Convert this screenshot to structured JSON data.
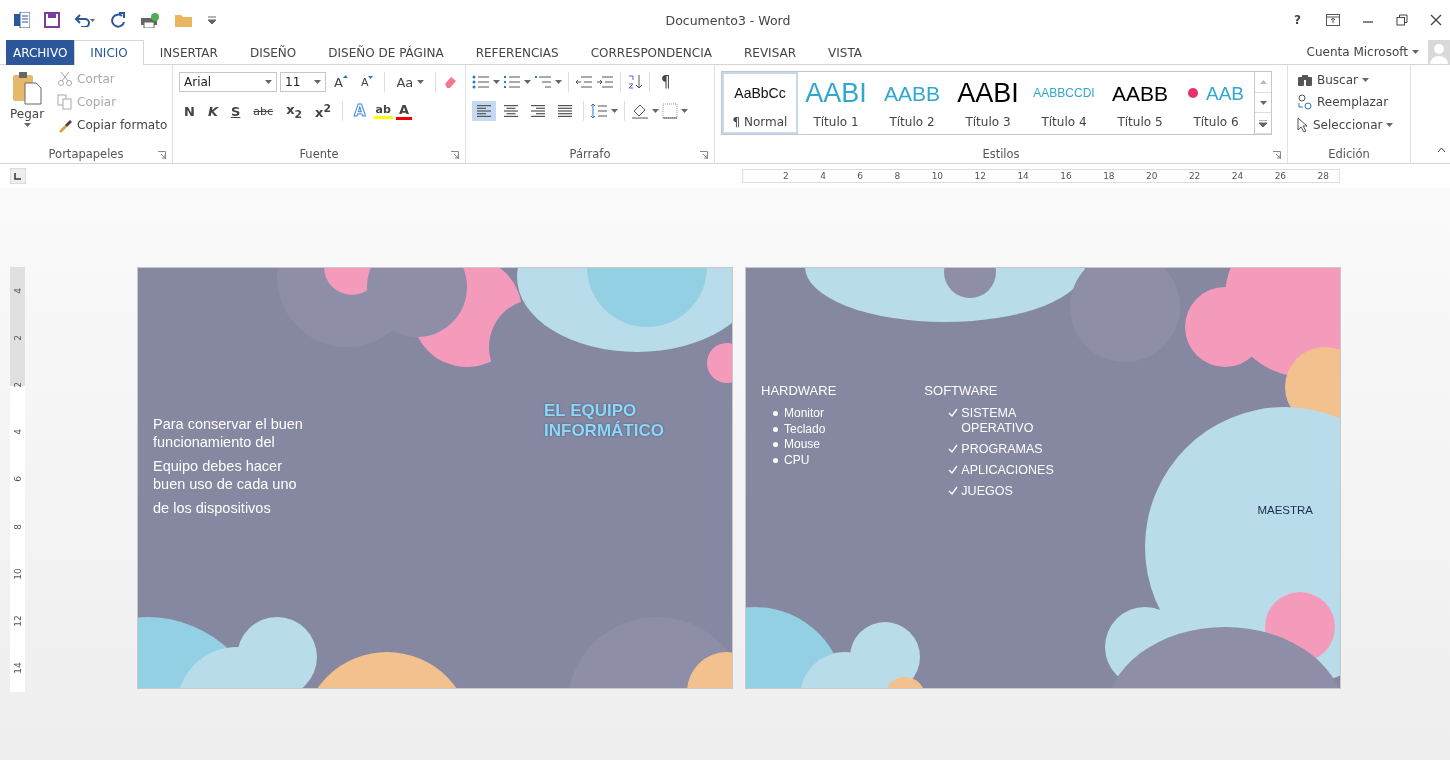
{
  "window": {
    "title": "Documento3 - Word",
    "help": "?",
    "account": "Cuenta Microsoft"
  },
  "tabs": [
    {
      "label": "ARCHIVO",
      "kind": "file",
      "selected": false
    },
    {
      "label": "INICIO",
      "kind": "tab",
      "selected": true
    },
    {
      "label": "INSERTAR",
      "kind": "tab",
      "selected": false
    },
    {
      "label": "DISEÑO",
      "kind": "tab",
      "selected": false
    },
    {
      "label": "DISEÑO DE PÁGINA",
      "kind": "tab",
      "selected": false
    },
    {
      "label": "REFERENCIAS",
      "kind": "tab",
      "selected": false
    },
    {
      "label": "CORRESPONDENCIA",
      "kind": "tab",
      "selected": false
    },
    {
      "label": "REVISAR",
      "kind": "tab",
      "selected": false
    },
    {
      "label": "VISTA",
      "kind": "tab",
      "selected": false
    }
  ],
  "ribbon": {
    "clipboard": {
      "paste": "Pegar",
      "items": [
        {
          "label": "Cortar",
          "kind": "cut",
          "disabled": true
        },
        {
          "label": "Copiar",
          "kind": "copy",
          "disabled": true
        },
        {
          "label": "Copiar formato",
          "kind": "brush",
          "disabled": false
        }
      ],
      "group": "Portapapeles"
    },
    "font": {
      "family": "Arial",
      "size": "11",
      "size_buttons": [
        "A",
        "A"
      ],
      "case_button": "Aa",
      "format_buttons": [
        "N",
        "K",
        "S",
        "abc",
        "x$_{2}$",
        "x$^{2}$"
      ],
      "effect_buttons": [
        "A",
        "ab",
        "A"
      ],
      "group": "Fuente"
    },
    "paragraph": {
      "marks_button": "¶",
      "alignments": [
        {
          "kind": "left",
          "selected": true
        },
        {
          "kind": "center",
          "selected": false
        },
        {
          "kind": "right",
          "selected": false
        },
        {
          "kind": "justify",
          "selected": false
        }
      ],
      "group": "Párrafo"
    },
    "styles": {
      "items": [
        {
          "preview": "AaBbCc",
          "label": "¶ Normal",
          "selected": true
        },
        {
          "preview": "AABI",
          "label": "Título 1",
          "selected": false
        },
        {
          "preview": "AABB",
          "label": "Título 2",
          "selected": false
        },
        {
          "preview": "AABI",
          "label": "Título 3",
          "selected": false
        },
        {
          "preview": "AABBCCDI",
          "label": "Título 4",
          "selected": false
        },
        {
          "preview": "AABB",
          "label": "Título 5",
          "selected": false
        },
        {
          "preview": "AAB",
          "label": "Título 6",
          "selected": false
        }
      ],
      "group": "Estilos"
    },
    "editing": {
      "items": [
        {
          "label": "Buscar",
          "kind": "find"
        },
        {
          "label": "Reemplazar",
          "kind": "replace"
        },
        {
          "label": "Seleccionar",
          "kind": "select"
        }
      ],
      "group": "Edición"
    }
  },
  "rulers": {
    "horizontal": [
      "2",
      "4",
      "6",
      "8",
      "10",
      "12",
      "14",
      "16",
      "18",
      "20",
      "22",
      "24",
      "26",
      "28"
    ],
    "vertical": [
      "4",
      "2",
      "2",
      "4",
      "6",
      "8",
      "10",
      "12",
      "14"
    ]
  },
  "pages": [
    {
      "kind": "cover",
      "paragraphs": [
        [
          "Para conservar el buen",
          "funcionamiento del"
        ],
        [
          "Equipo debes hacer",
          "buen uso de cada uno"
        ],
        [
          "de los dispositivos"
        ]
      ],
      "title": "EL EQUIPO INFORMÁTICO"
    },
    {
      "kind": "lists",
      "hardware": {
        "heading": "HARDWARE",
        "items": [
          "Monitor",
          "Teclado",
          "Mouse",
          "CPU"
        ]
      },
      "software": {
        "heading": "SOFTWARE",
        "items": [
          "SISTEMA OPERATIVO",
          "PROGRAMAS",
          "APLICACIONES",
          "JUEGOS"
        ]
      },
      "signature": "MAESTRA"
    }
  ]
}
